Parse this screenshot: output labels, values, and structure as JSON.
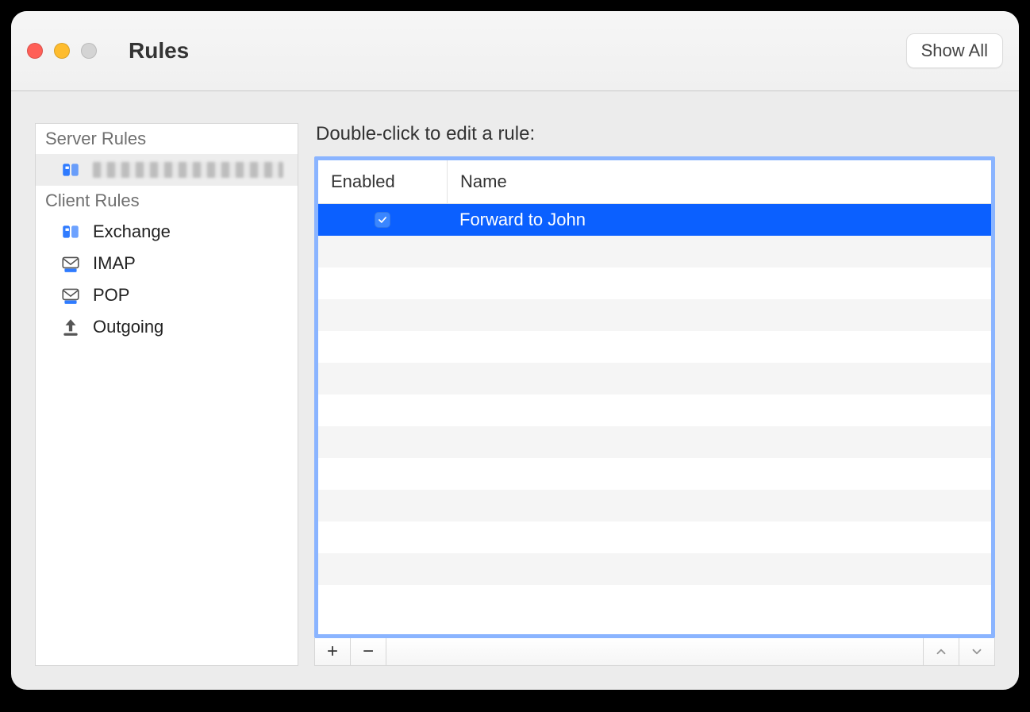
{
  "window": {
    "title": "Rules",
    "show_all_label": "Show All"
  },
  "sidebar": {
    "sections": [
      {
        "header": "Server Rules",
        "items": [
          {
            "label": "",
            "icon": "exchange-icon",
            "selected": true,
            "redacted": true
          }
        ]
      },
      {
        "header": "Client Rules",
        "items": [
          {
            "label": "Exchange",
            "icon": "exchange-icon",
            "selected": false,
            "redacted": false
          },
          {
            "label": "IMAP",
            "icon": "imap-icon",
            "selected": false,
            "redacted": false
          },
          {
            "label": "POP",
            "icon": "pop-icon",
            "selected": false,
            "redacted": false
          },
          {
            "label": "Outgoing",
            "icon": "outgoing-icon",
            "selected": false,
            "redacted": false
          }
        ]
      }
    ]
  },
  "main": {
    "hint": "Double-click to edit a rule:",
    "columns": {
      "enabled": "Enabled",
      "name": "Name"
    },
    "rules": [
      {
        "enabled": true,
        "name": "Forward to John",
        "selected": true
      }
    ],
    "visible_row_slots": 13
  },
  "footer": {
    "add_tooltip": "Add",
    "remove_tooltip": "Remove",
    "up_tooltip": "Move Up",
    "down_tooltip": "Move Down"
  },
  "icons": {
    "exchange-icon": "exchange",
    "imap-icon": "imap",
    "pop-icon": "pop",
    "outgoing-icon": "outgoing"
  }
}
